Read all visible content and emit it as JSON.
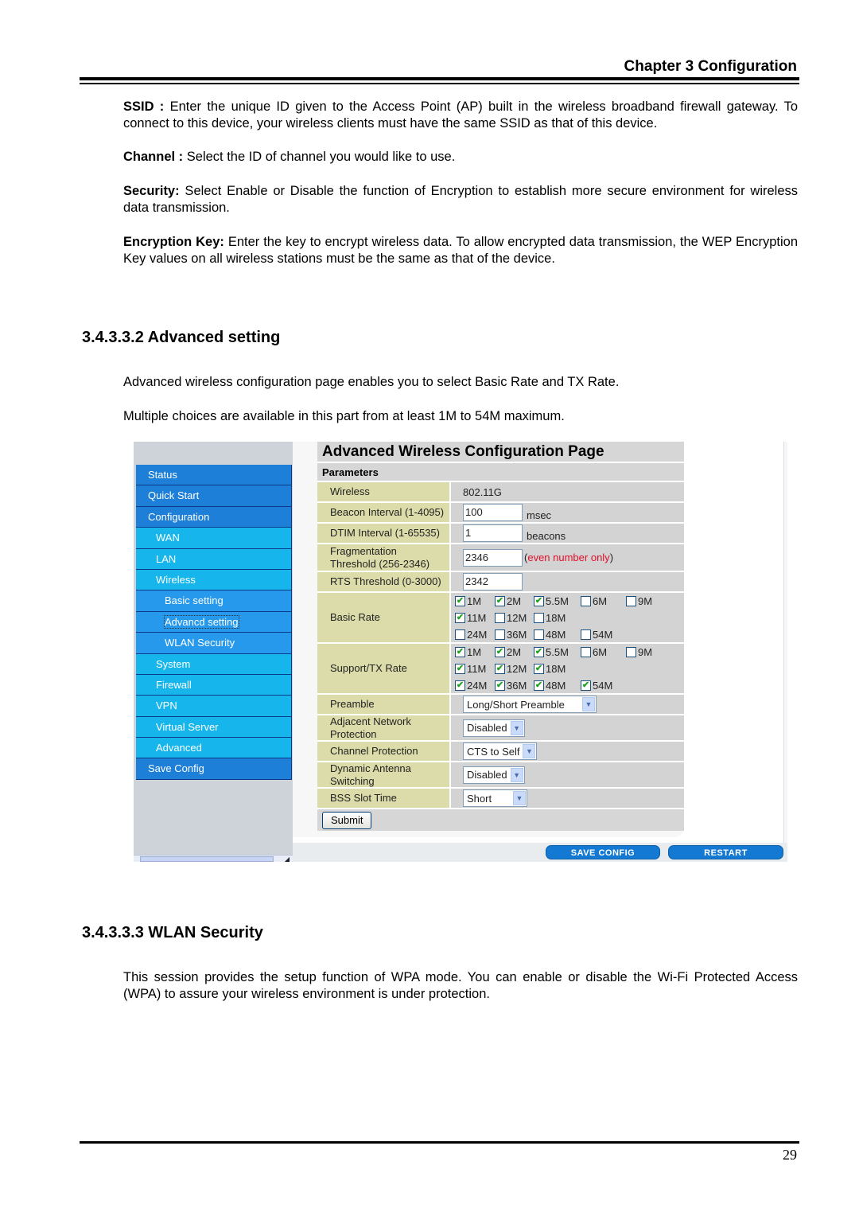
{
  "header": {
    "chapter": "Chapter 3 Configuration"
  },
  "intro_paragraphs": [
    {
      "term": "SSID :",
      "text": " Enter the unique ID given to the Access Point (AP) built in the wireless broadband firewall gateway. To connect to this device, your wireless clients must have the same SSID as that of this device."
    },
    {
      "term": "Channel :",
      "text": " Select the ID of channel you would like to use."
    },
    {
      "term": "Security:",
      "text": " Select Enable or Disable the function of Encryption to establish more secure environment for wireless data transmission."
    },
    {
      "term": "Encryption Key:",
      "text": " Enter the key to encrypt wireless data. To allow encrypted data transmission, the WEP Encryption Key values on all wireless stations must be the same as that of the device."
    }
  ],
  "advanced_section": {
    "heading": "3.4.3.3.2 Advanced setting",
    "paragraphs": [
      "Advanced wireless configuration page enables you to select Basic Rate and TX Rate.",
      "Multiple choices are available in this part from at least 1M to 54M maximum."
    ]
  },
  "screenshot": {
    "sidebar": [
      {
        "label": "Status",
        "level": 1
      },
      {
        "label": "Quick Start",
        "level": 1
      },
      {
        "label": "Configuration",
        "level": 1
      },
      {
        "label": "WAN",
        "level": 2
      },
      {
        "label": "LAN",
        "level": 2
      },
      {
        "label": "Wireless",
        "level": 2
      },
      {
        "label": "Basic setting",
        "level": 3
      },
      {
        "label": "Advancd setting",
        "level": 3,
        "active": true
      },
      {
        "label": "WLAN Security",
        "level": 3
      },
      {
        "label": "System",
        "level": 2
      },
      {
        "label": "Firewall",
        "level": 2
      },
      {
        "label": "VPN",
        "level": 2
      },
      {
        "label": "Virtual Server",
        "level": 2
      },
      {
        "label": "Advanced",
        "level": 2
      },
      {
        "label": "Save Config",
        "level": 1
      }
    ],
    "page_title": "Advanced Wireless Configuration Page",
    "params_header": "Parameters",
    "fields": {
      "wireless": {
        "label": "Wireless",
        "value": "802.11G"
      },
      "beacon": {
        "label": "Beacon Interval (1-4095)",
        "value": "100",
        "unit": "msec"
      },
      "dtim": {
        "label": "DTIM Interval (1-65535)",
        "value": "1",
        "unit": "beacons"
      },
      "frag": {
        "label_1": "Fragmentation",
        "label_2": "Threshold (256-2346)",
        "value": "2346",
        "hint_open": "(",
        "hint": "even number only",
        "hint_close": ")"
      },
      "rts": {
        "label": "RTS Threshold (0-3000)",
        "value": "2342"
      },
      "basic_rate": {
        "label": "Basic Rate",
        "rows": [
          [
            {
              "rate": "1M",
              "checked": true
            },
            {
              "rate": "2M",
              "checked": true
            },
            {
              "rate": "5.5M",
              "checked": true
            },
            {
              "rate": "6M",
              "checked": false
            },
            {
              "rate": "9M",
              "checked": false
            }
          ],
          [
            {
              "rate": "11M",
              "checked": true
            },
            {
              "rate": "12M",
              "checked": false
            },
            {
              "rate": "18M",
              "checked": false
            }
          ],
          [
            {
              "rate": "24M",
              "checked": false
            },
            {
              "rate": "36M",
              "checked": false
            },
            {
              "rate": "48M",
              "checked": false
            },
            {
              "rate": "54M",
              "checked": false
            }
          ]
        ]
      },
      "tx_rate": {
        "label": "Support/TX Rate",
        "rows": [
          [
            {
              "rate": "1M",
              "checked": true
            },
            {
              "rate": "2M",
              "checked": true
            },
            {
              "rate": "5.5M",
              "checked": true
            },
            {
              "rate": "6M",
              "checked": false
            },
            {
              "rate": "9M",
              "checked": false
            }
          ],
          [
            {
              "rate": "11M",
              "checked": true
            },
            {
              "rate": "12M",
              "checked": true
            },
            {
              "rate": "18M",
              "checked": true
            }
          ],
          [
            {
              "rate": "24M",
              "checked": true
            },
            {
              "rate": "36M",
              "checked": true
            },
            {
              "rate": "48M",
              "checked": true
            },
            {
              "rate": "54M",
              "checked": true
            }
          ]
        ]
      },
      "preamble": {
        "label": "Preamble",
        "value": "Long/Short Preamble"
      },
      "adjacent": {
        "label_1": "Adjacent Network",
        "label_2": "Protection",
        "value": "Disabled"
      },
      "channel_prot": {
        "label": "Channel Protection",
        "value": "CTS to Self"
      },
      "antenna": {
        "label_1": "Dynamic Antenna",
        "label_2": "Switching",
        "value": "Disabled"
      },
      "slot": {
        "label": "BSS Slot Time",
        "value": "Short"
      }
    },
    "submit_label": "Submit",
    "save_config_label": "SAVE CONFIG",
    "restart_label": "RESTART",
    "colors": {
      "nav_top": "#1d7fd8",
      "nav_sub": "#16b6ec",
      "nav_subsub": "#2799ec",
      "label_cell": "#dcdcaa",
      "value_cell": "#d3d3d3",
      "hint_red": "#e0102a",
      "check_green": "#21a121"
    }
  },
  "wlan_section": {
    "heading": "3.4.3.3.3 WLAN Security",
    "paragraph": "This session provides the setup function of WPA mode. You can enable or disable the Wi-Fi Protected Access (WPA) to assure your wireless environment is under protection."
  },
  "footer": {
    "page_number": "29"
  }
}
